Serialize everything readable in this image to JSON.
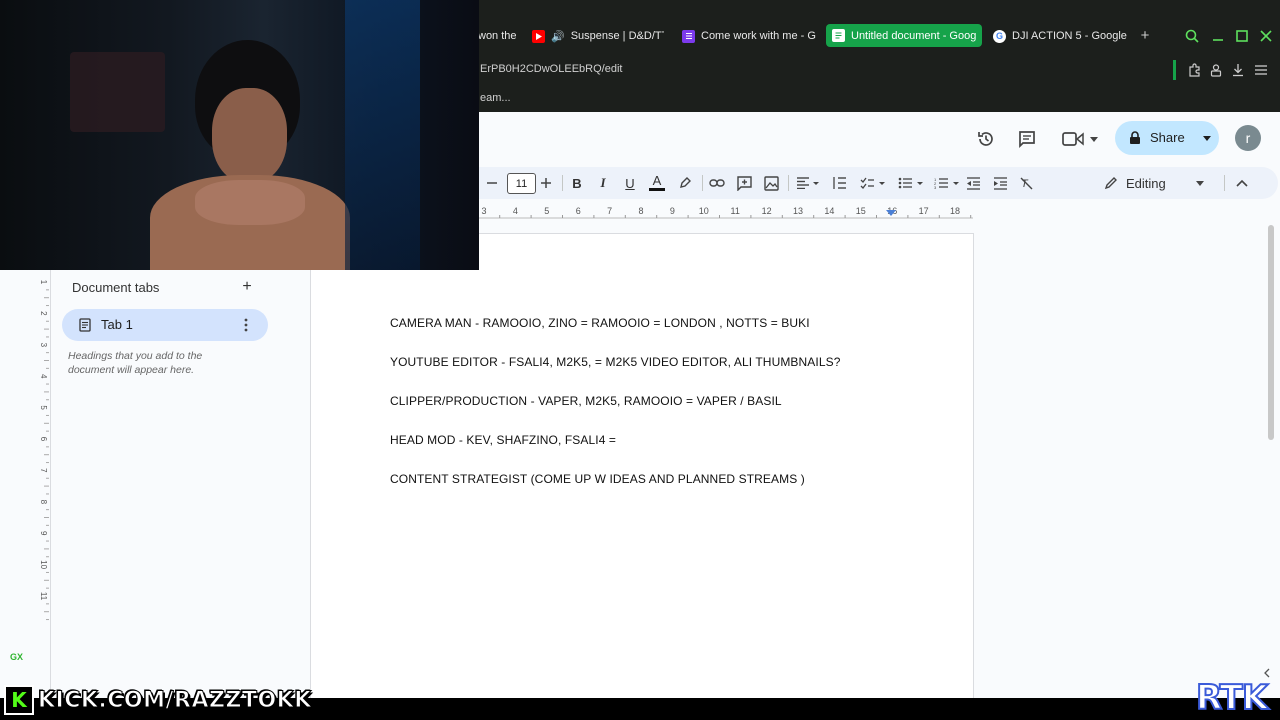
{
  "browser": {
    "tabs": [
      {
        "label": "won the",
        "icon": "tab-partial"
      },
      {
        "label": "Suspense | D&D/TT",
        "icon": "youtube-icon"
      },
      {
        "label": "Come work with me - G",
        "icon": "form-icon"
      },
      {
        "label": "Untitled document - Goog",
        "icon": "docs-icon",
        "active": true
      },
      {
        "label": "DJI ACTION 5 - Google",
        "icon": "google-icon"
      }
    ],
    "address": "ErPB0H2CDwOLEEbRQ/edit",
    "bookmark": "eam..."
  },
  "docs": {
    "share_label": "Share",
    "avatar_letter": "r",
    "font_size": "11",
    "editing_label": "Editing",
    "ruler_ticks": [
      "3",
      "4",
      "5",
      "6",
      "7",
      "8",
      "9",
      "10",
      "11",
      "12",
      "13",
      "14",
      "15",
      "16",
      "17",
      "18"
    ],
    "vruler_ticks": [
      "1",
      "2",
      "3",
      "4",
      "5",
      "6",
      "7",
      "8",
      "9",
      "10",
      "11"
    ]
  },
  "sidebar": {
    "title": "Document tabs",
    "tab1_label": "Tab 1",
    "hint": "Headings that you add to the document will appear here."
  },
  "document": {
    "lines": [
      "CAMERA MAN - RAMOOIO, ZINO = RAMOOIO = LONDON , NOTTS = BUKI",
      "YOUTUBE EDITOR - FSALI4, M2K5, = M2K5 VIDEO EDITOR, ALI THUMBNAILS?",
      "CLIPPER/PRODUCTION  - VAPER, M2K5, RAMOOIO = VAPER / BASIL",
      "HEAD MOD -  KEV, SHAFZINO, FSALI4  =",
      "CONTENT STRATEGIST (COME UP W IDEAS AND PLANNED STREAMS )"
    ]
  },
  "overlay": {
    "kick_text": "KICK.COM/RAZZTOKK",
    "gx": "GX",
    "rtk": "RTK"
  },
  "colors": {
    "active_tab": "#16a34a",
    "share_bg": "#c2e7ff",
    "kick_green": "#53fc18"
  }
}
